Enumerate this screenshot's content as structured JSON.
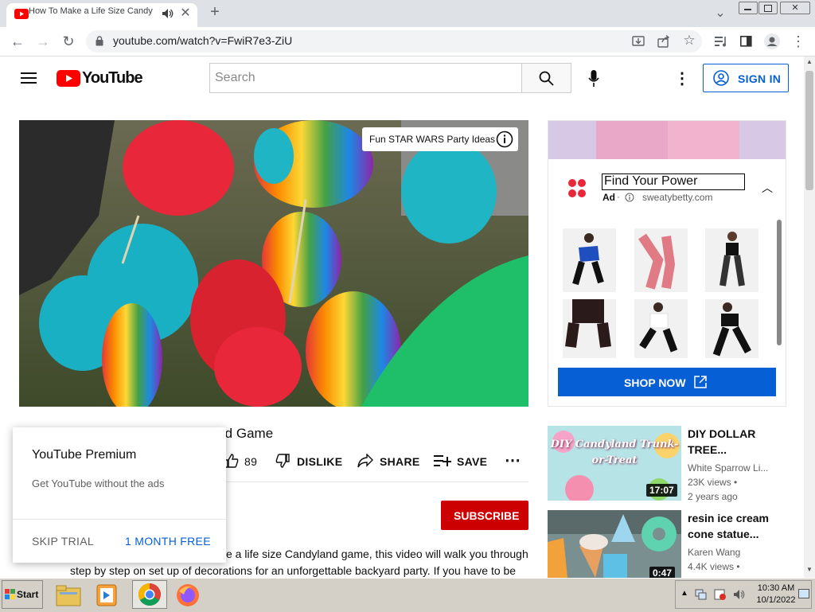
{
  "browser": {
    "tab_title": "How To Make a Life Size Candy",
    "url": "youtube.com/watch?v=FwiR7e3-ZiU"
  },
  "header": {
    "logo_text": "YouTube",
    "search_placeholder": "Search",
    "signin_label": "SIGN IN"
  },
  "video": {
    "overlay_pill": "Fun STAR WARS Party Ideas",
    "title_visible": "land Game",
    "likes": "89",
    "dislike_label": "DISLIKE",
    "share_label": "SHARE",
    "save_label": "SAVE",
    "subscribe_label": "SUBSCRIBE",
    "description_line1": "e a life size Candyland game, this video will walk you through",
    "description_line2": "step by step on set up of decorations for an unforgettable backyard party. If you have to be"
  },
  "ad": {
    "headline": "Find Your Power",
    "ad_badge": "Ad",
    "domain": "sweatybetty.com",
    "shop_label": "SHOP NOW"
  },
  "related": [
    {
      "title_line1": "DIY DOLLAR",
      "title_line2": "TREE...",
      "channel": "White Sparrow Li...",
      "views": "23K views",
      "age": "2 years ago",
      "duration": "17:07",
      "thumb_text": "DIY Candyland Trunk-or-Treat"
    },
    {
      "title_line1": "resin ice cream",
      "title_line2": "cone statue...",
      "channel": "Karen Wang",
      "views": "4.4K views",
      "age": "",
      "duration": "0:47"
    }
  ],
  "popup": {
    "title": "YouTube Premium",
    "subtitle": "Get YouTube without the ads",
    "skip_label": "SKIP TRIAL",
    "free_label": "1 MONTH FREE"
  },
  "taskbar": {
    "start_label": "Start",
    "time": "10:30 AM",
    "date": "10/1/2022"
  },
  "colors": {
    "yt_red": "#ff0000",
    "link_blue": "#065fd4",
    "subscribe_red": "#cc0000"
  }
}
